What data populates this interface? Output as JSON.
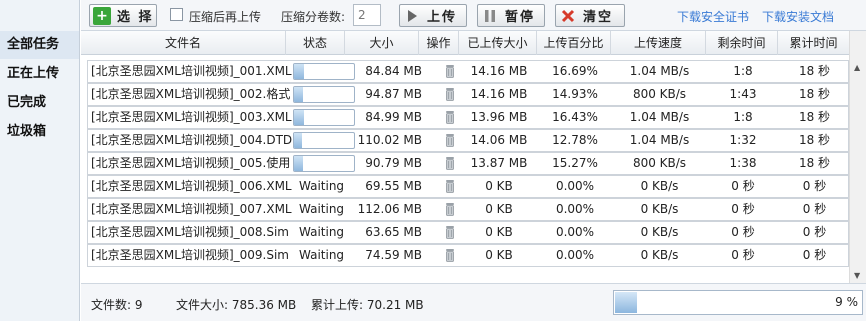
{
  "sidebar": {
    "items": [
      {
        "label": "全部任务",
        "active": true
      },
      {
        "label": "正在上传",
        "active": false
      },
      {
        "label": "已完成",
        "active": false
      },
      {
        "label": "垃圾箱",
        "active": false
      }
    ]
  },
  "toolbar": {
    "select_label": "选 择",
    "compress_label": "压缩后再上传",
    "volume_label": "压缩分卷数:",
    "volume_value": "2",
    "upload_label": "上传",
    "pause_label": "暂停",
    "clear_label": "清空",
    "cert_link": "下载安全证书",
    "install_link": "下载安装文档"
  },
  "table": {
    "headers": [
      "文件名",
      "状态",
      "大小",
      "操作",
      "已上传大小",
      "上传百分比",
      "上传速度",
      "剩余时间",
      "累计时间"
    ],
    "rows": [
      {
        "name": "[北京圣思园XML培训视频]_001.XML",
        "status": "",
        "progress": 0.1669,
        "size": "84.84 MB",
        "uploaded": "14.16 MB",
        "percent": "16.69%",
        "speed": "1.04 MB/s",
        "remaining": "1:8",
        "elapsed": "18 秒"
      },
      {
        "name": "[北京圣思园XML培训视频]_002.格式",
        "status": "",
        "progress": 0.1493,
        "size": "94.87 MB",
        "uploaded": "14.16 MB",
        "percent": "14.93%",
        "speed": "800 KB/s",
        "remaining": "1:43",
        "elapsed": "18 秒"
      },
      {
        "name": "[北京圣思园XML培训视频]_003.XML",
        "status": "",
        "progress": 0.1643,
        "size": "84.99 MB",
        "uploaded": "13.96 MB",
        "percent": "16.43%",
        "speed": "1.04 MB/s",
        "remaining": "1:8",
        "elapsed": "18 秒"
      },
      {
        "name": "[北京圣思园XML培训视频]_004.DTD",
        "status": "",
        "progress": 0.1278,
        "size": "110.02 MB",
        "uploaded": "14.06 MB",
        "percent": "12.78%",
        "speed": "1.04 MB/s",
        "remaining": "1:32",
        "elapsed": "18 秒"
      },
      {
        "name": "[北京圣思园XML培训视频]_005.使用",
        "status": "",
        "progress": 0.1527,
        "size": "90.79 MB",
        "uploaded": "13.87 MB",
        "percent": "15.27%",
        "speed": "800 KB/s",
        "remaining": "1:38",
        "elapsed": "18 秒"
      },
      {
        "name": "[北京圣思园XML培训视频]_006.XML",
        "status": "Waiting",
        "progress": null,
        "size": "69.55 MB",
        "uploaded": "0 KB",
        "percent": "0.00%",
        "speed": "0 KB/s",
        "remaining": "0 秒",
        "elapsed": "0 秒"
      },
      {
        "name": "[北京圣思园XML培训视频]_007.XML",
        "status": "Waiting",
        "progress": null,
        "size": "112.06 MB",
        "uploaded": "0 KB",
        "percent": "0.00%",
        "speed": "0 KB/s",
        "remaining": "0 秒",
        "elapsed": "0 秒"
      },
      {
        "name": "[北京圣思园XML培训视频]_008.Sim",
        "status": "Waiting",
        "progress": null,
        "size": "63.65 MB",
        "uploaded": "0 KB",
        "percent": "0.00%",
        "speed": "0 KB/s",
        "remaining": "0 秒",
        "elapsed": "0 秒"
      },
      {
        "name": "[北京圣思园XML培训视频]_009.Sim",
        "status": "Waiting",
        "progress": null,
        "size": "74.59 MB",
        "uploaded": "0 KB",
        "percent": "0.00%",
        "speed": "0 KB/s",
        "remaining": "0 秒",
        "elapsed": "0 秒"
      }
    ]
  },
  "footer": {
    "file_count": "文件数: 9",
    "file_size": "文件大小: 785.36 MB",
    "uploaded_total": "累计上传: 70.21 MB",
    "total_progress": 0.09,
    "total_percent": "9 %"
  },
  "colors": {
    "accent": "#3a7bd5",
    "select_icon": "#3aa63a",
    "clear_icon": "#d63a2a",
    "progress_fill": "#8fb7dd"
  }
}
